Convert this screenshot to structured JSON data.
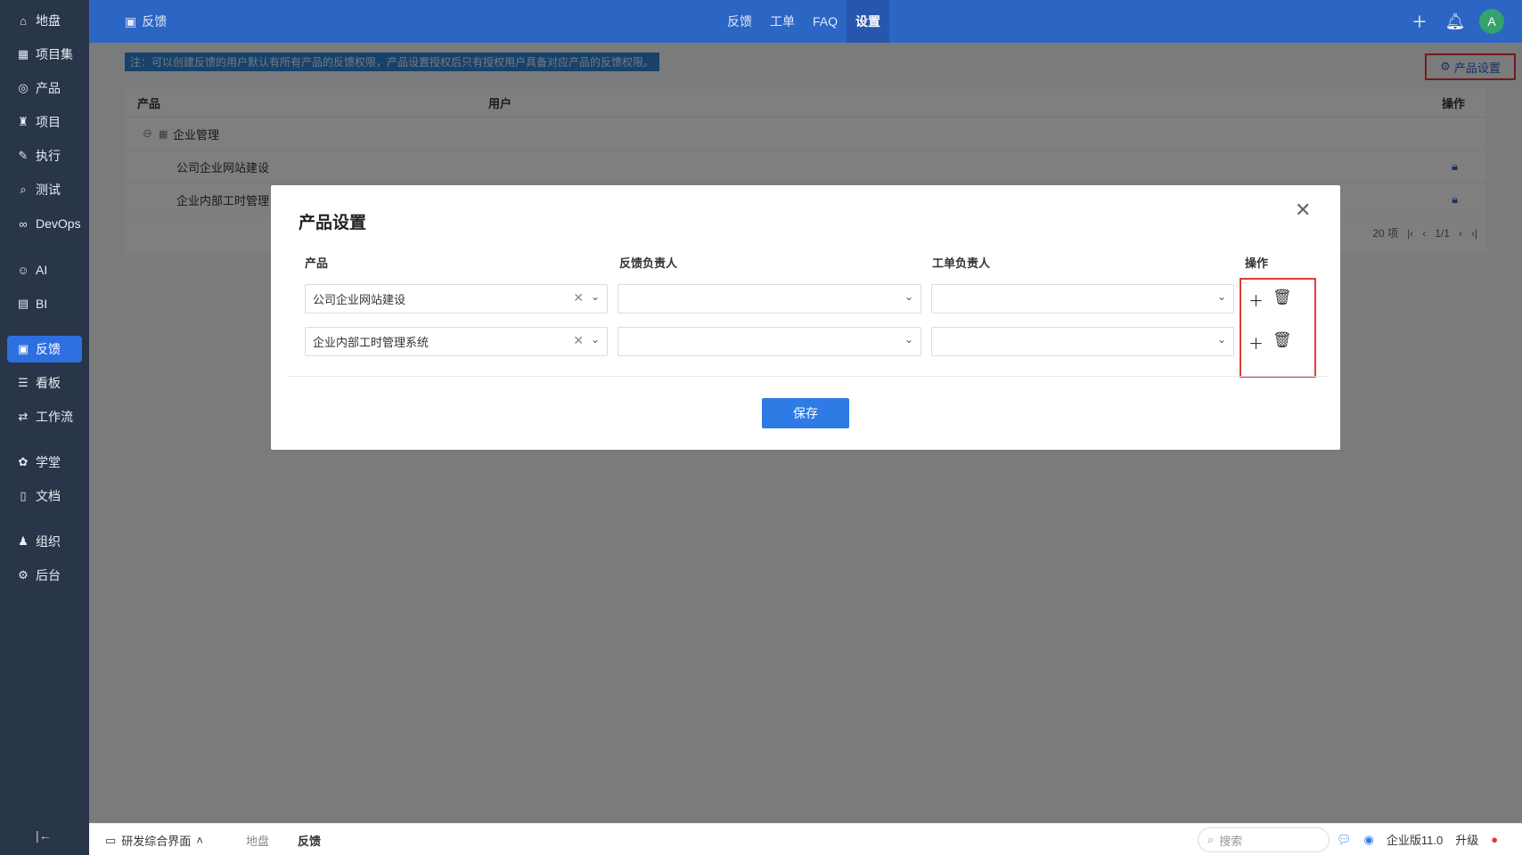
{
  "sidebar": {
    "items": [
      {
        "label": "地盘",
        "icon": "⌂"
      },
      {
        "label": "项目集",
        "icon": "▦"
      },
      {
        "label": "产品",
        "icon": "◎"
      },
      {
        "label": "项目",
        "icon": "♜"
      },
      {
        "label": "执行",
        "icon": "✎"
      },
      {
        "label": "测试",
        "icon": "⌕"
      },
      {
        "label": "DevOps",
        "icon": "∞"
      },
      {
        "label": "AI",
        "icon": "☺"
      },
      {
        "label": "BI",
        "icon": "▤"
      },
      {
        "label": "反馈",
        "icon": "▣"
      },
      {
        "label": "看板",
        "icon": "☰"
      },
      {
        "label": "工作流",
        "icon": "⇄"
      },
      {
        "label": "学堂",
        "icon": "✿"
      },
      {
        "label": "文档",
        "icon": "▯"
      },
      {
        "label": "组织",
        "icon": "♟"
      },
      {
        "label": "后台",
        "icon": "⚙"
      }
    ],
    "active_label": "反馈",
    "collapse_icon": "|←"
  },
  "topbar": {
    "page_title": "反馈",
    "tabs": [
      "反馈",
      "工单",
      "FAQ",
      "设置"
    ],
    "active_tab": "设置",
    "avatar_letter": "A"
  },
  "main": {
    "notice": "注：可以创建反馈的用户默认有所有产品的反馈权限，产品设置授权后只有授权用户具备对应产品的反馈权限。",
    "product_settings_link": "产品设置",
    "grid": {
      "columns": [
        "产品",
        "用户",
        "操作"
      ],
      "group": "企业管理",
      "rows": [
        "公司企业网站建设",
        "企业内部工时管理"
      ],
      "pager": {
        "per_page": "20 项",
        "pages": "1/1"
      }
    }
  },
  "dialog": {
    "title": "产品设置",
    "columns": [
      "产品",
      "反馈负责人",
      "工单负责人",
      "操作"
    ],
    "rows": [
      {
        "product": "公司企业网站建设",
        "feedback_owner": "",
        "ticket_owner": ""
      },
      {
        "product": "企业内部工时管理系统",
        "feedback_owner": "",
        "ticket_owner": ""
      }
    ],
    "save_label": "保存"
  },
  "bottombar": {
    "workspace": "研发综合界面",
    "crumbs": [
      "地盘",
      "反馈"
    ],
    "search_placeholder": "搜索",
    "edition": "企业版11.0",
    "upgrade": "升级"
  },
  "colors": {
    "sidebar_bg": "#293548",
    "topbar_bg": "#2c66c4",
    "accent": "#2e7be6",
    "highlight_border": "#e53935"
  }
}
